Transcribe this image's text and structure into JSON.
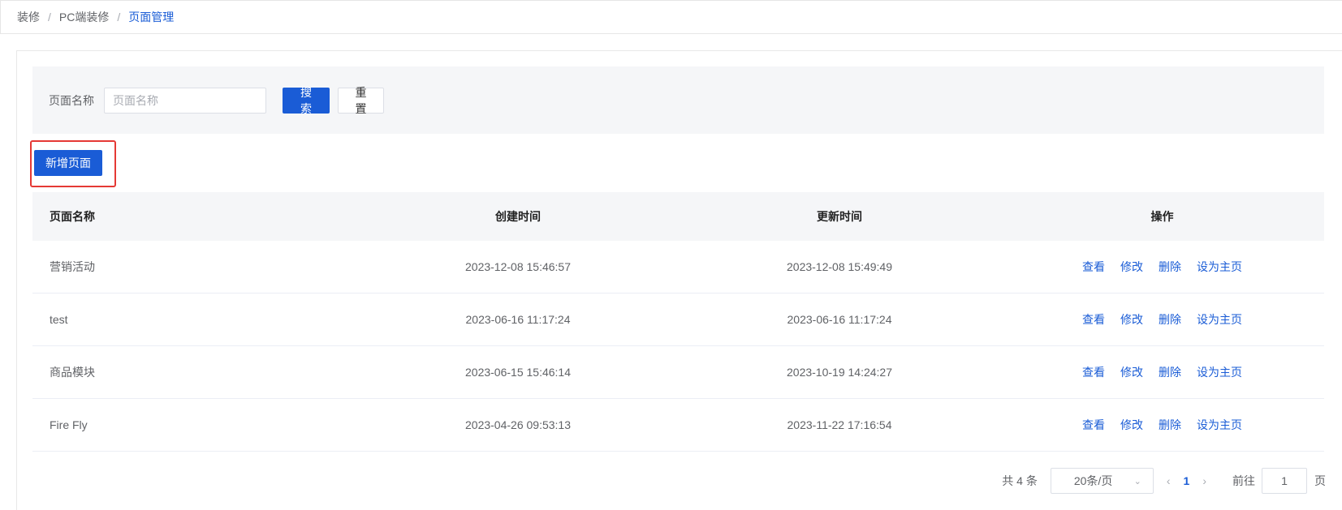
{
  "breadcrumb": {
    "items": [
      "装修",
      "PC端装修",
      "页面管理"
    ],
    "separator": "/"
  },
  "filter": {
    "label": "页面名称",
    "input_placeholder": "页面名称",
    "input_value": "",
    "search_label": "搜索",
    "reset_label": "重置"
  },
  "toolbar": {
    "add_label": "新增页面"
  },
  "table": {
    "columns": [
      "页面名称",
      "创建时间",
      "更新时间",
      "操作"
    ],
    "rows": [
      {
        "name": "营销活动",
        "created": "2023-12-08 15:46:57",
        "updated": "2023-12-08 15:49:49"
      },
      {
        "name": "test",
        "created": "2023-06-16 11:17:24",
        "updated": "2023-06-16 11:17:24"
      },
      {
        "name": "商品模块",
        "created": "2023-06-15 15:46:14",
        "updated": "2023-10-19 14:24:27"
      },
      {
        "name": "Fire Fly",
        "created": "2023-04-26 09:53:13",
        "updated": "2023-11-22 17:16:54"
      }
    ],
    "actions": [
      "查看",
      "修改",
      "删除",
      "设为主页"
    ]
  },
  "pagination": {
    "total_text": "共 4 条",
    "page_size": "20条/页",
    "current_page": "1",
    "goto_label": "前往",
    "goto_value": "1",
    "page_suffix": "页"
  },
  "icons": {
    "prev": "chevron-left-icon",
    "next": "chevron-right-icon",
    "select": "chevron-down-icon"
  },
  "colors": {
    "primary": "#1a5cd6",
    "highlight_border": "#e53935"
  }
}
